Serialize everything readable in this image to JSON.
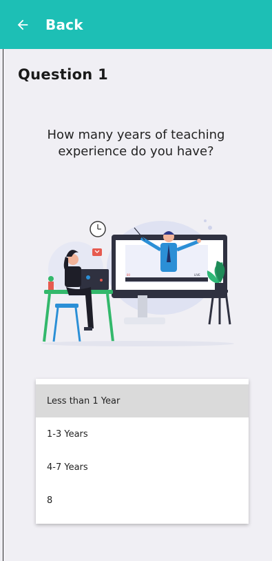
{
  "app_bar": {
    "back_label": "Back",
    "icon": "back-arrow-icon",
    "color": "#1dbfb5"
  },
  "question": {
    "title": "Question 1",
    "text": "How many years of teaching experience do you have?"
  },
  "illustration": {
    "subject": "woman at laptop watching teacher on monitor",
    "video_badge_count": "80",
    "video_badge_live": "LIVE"
  },
  "options": {
    "selected_index": 0,
    "items": [
      {
        "label": "Less than 1 Year"
      },
      {
        "label": "1-3 Years"
      },
      {
        "label": "4-7 Years"
      },
      {
        "label": "8"
      }
    ]
  }
}
